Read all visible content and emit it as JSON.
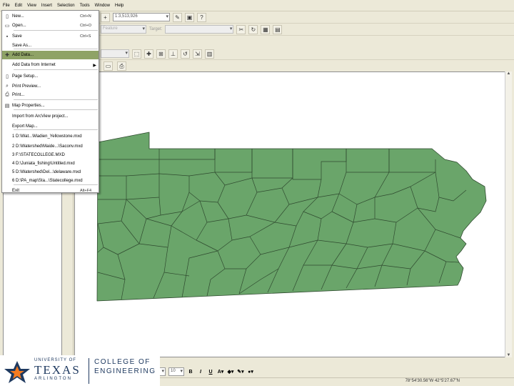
{
  "menubar": {
    "items": [
      "File",
      "Edit",
      "View",
      "Insert",
      "Selection",
      "Tools",
      "Window",
      "Help"
    ]
  },
  "toolbar1": {
    "scale_value": "1:3,513,926"
  },
  "toolbar2": {
    "layer_value": "Feature",
    "target_label": "Target:"
  },
  "file_menu": {
    "items": [
      {
        "label": "New...",
        "shortcut": "Ctrl+N",
        "icon": "new-document-icon"
      },
      {
        "label": "Open...",
        "shortcut": "Ctrl+O",
        "icon": "open-folder-icon"
      },
      {
        "label": "Save",
        "shortcut": "Ctrl+S",
        "icon": "save-icon"
      },
      {
        "label": "Save As...",
        "shortcut": "",
        "icon": ""
      },
      {
        "label": "Add Data...",
        "shortcut": "",
        "icon": "add-data-icon",
        "highlighted": true
      },
      {
        "label": "Add Data from Internet",
        "shortcut": "",
        "icon": "",
        "submenu": true
      },
      {
        "label": "Page Setup...",
        "shortcut": "",
        "icon": "page-setup-icon"
      },
      {
        "label": "Print Preview...",
        "shortcut": "",
        "icon": "print-preview-icon"
      },
      {
        "label": "Print...",
        "shortcut": "",
        "icon": "print-icon"
      },
      {
        "label": "Map Properties...",
        "shortcut": "",
        "icon": "map-properties-icon"
      },
      {
        "label": "Import from ArcView project...",
        "shortcut": "",
        "icon": ""
      },
      {
        "label": "Export Map...",
        "shortcut": "",
        "icon": ""
      },
      {
        "label": "1 D:\\Wat...\\Madien_Yellowstone.mxd",
        "shortcut": "",
        "icon": ""
      },
      {
        "label": "2 D:\\Watershed\\Maide...\\Saconv.mxd",
        "shortcut": "",
        "icon": ""
      },
      {
        "label": "3 F:\\STATECOLLEGE.MXD",
        "shortcut": "",
        "icon": ""
      },
      {
        "label": "4 D:\\Juniata_fishing\\Untitled.mxd",
        "shortcut": "",
        "icon": ""
      },
      {
        "label": "5 D:\\Watershed\\Del...\\delaware.mxd",
        "shortcut": "",
        "icon": ""
      },
      {
        "label": "6 D:\\PA_map\\Sta...\\Statecollege.mxd",
        "shortcut": "",
        "icon": ""
      },
      {
        "label": "Exit",
        "shortcut": "Alt+F4",
        "icon": ""
      }
    ]
  },
  "drawing_toolbar": {
    "font_size": "10",
    "bold": "B",
    "italic": "I",
    "underline": "U"
  },
  "status": {
    "coordinates": "78°54'30.56\"W  42°5'27.67\"N"
  },
  "logo": {
    "university_of": "UNIVERSITY OF",
    "texas": "TEXAS",
    "arlington": "ARLINGTON",
    "college_of": "COLLEGE OF",
    "engineering": "ENGINEERING"
  },
  "colors": {
    "map_fill": "#6aa56a",
    "map_border": "#2f4a2f",
    "menu_highlight": "#8fa366"
  }
}
